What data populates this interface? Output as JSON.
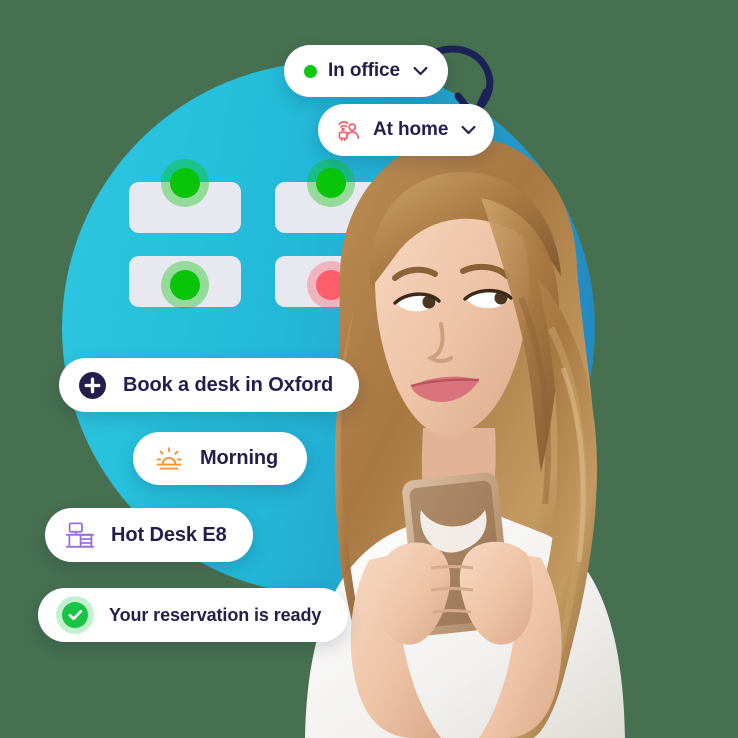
{
  "palette": {
    "background": "#477050",
    "circle_from": "#2ec6e0",
    "circle_to": "#2484be",
    "chip_bg": "#ffffff",
    "text_navy": "#231f4d",
    "status_green": "#0ac40a",
    "status_red": "#fc5f6b",
    "accent_orange": "#f59331",
    "accent_purple": "#9b6ee0",
    "accent_coral": "#f4606d",
    "check_green": "#18c443",
    "card_grey": "#e8e8f0"
  },
  "status_chips": [
    {
      "id": "in-office",
      "label": "In office",
      "icon": "status-dot-green",
      "chevron": "chevron-down-icon"
    },
    {
      "id": "at-home",
      "label": "At home",
      "icon": "remote-worker-icon",
      "chevron": "chevron-down-icon"
    }
  ],
  "desk_grid": {
    "cards": [
      {
        "id": "desk-1",
        "status": "available",
        "status_color": "#0ac40a"
      },
      {
        "id": "desk-2",
        "status": "available",
        "status_color": "#0ac40a"
      },
      {
        "id": "desk-3",
        "status": "available",
        "status_color": "#0ac40a"
      },
      {
        "id": "desk-4",
        "status": "occupied",
        "status_color": "#fc5f6b"
      }
    ]
  },
  "action_chips": [
    {
      "id": "book-desk",
      "label": "Book a desk in Oxford",
      "icon": "plus-circle-icon"
    },
    {
      "id": "time-slot",
      "label": "Morning",
      "icon": "sunrise-icon"
    },
    {
      "id": "desk-name",
      "label": "Hot Desk E8",
      "icon": "desk-icon"
    },
    {
      "id": "reservation",
      "label": "Your reservation is ready",
      "icon": "check-circle-icon"
    }
  ],
  "annotation": {
    "arrow": "curved-arrow-down-icon"
  },
  "photo": {
    "subject": "woman-holding-phone"
  }
}
